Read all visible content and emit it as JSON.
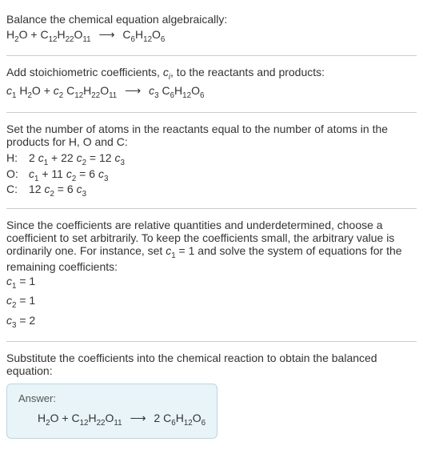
{
  "intro": {
    "line1": "Balance the chemical equation algebraically:"
  },
  "eq1": {
    "h2o": "H",
    "h2o_2": "2",
    "h2o_o": "O",
    "plus": " + ",
    "c12": "C",
    "c12_12": "12",
    "c12_h": "H",
    "c12_22": "22",
    "c12_o": "O",
    "c12_11": "11",
    "arrow": "⟶",
    "c6": "C",
    "c6_6": "6",
    "c6_h": "H",
    "c6_12": "12",
    "c6_o": "O",
    "c6_o6": "6"
  },
  "step2": {
    "text_a": "Add stoichiometric coefficients, ",
    "ci_c": "c",
    "ci_i": "i",
    "text_b": ", to the reactants and products:"
  },
  "eq2": {
    "c1": "c",
    "c1_1": "1",
    "sp1": " ",
    "c2": "c",
    "c2_2": "2",
    "sp2": " ",
    "c3": "c",
    "c3_3": "3",
    "sp3": " "
  },
  "step3": {
    "text": "Set the number of atoms in the reactants equal to the number of atoms in the products for H, O and C:"
  },
  "atoms": {
    "h_label": "H:",
    "h_eq_a": "2 ",
    "h_c1": "c",
    "h_1": "1",
    "h_plus": " + 22 ",
    "h_c2": "c",
    "h_2": "2",
    "h_eq": " = 12 ",
    "h_c3": "c",
    "h_3": "3",
    "o_label": "O:",
    "o_c1": "c",
    "o_1": "1",
    "o_plus": " + 11 ",
    "o_c2": "c",
    "o_2": "2",
    "o_eq": " = 6 ",
    "o_c3": "c",
    "o_3": "3",
    "c_label": "C:",
    "c_12": "12 ",
    "c_c2": "c",
    "c_2": "2",
    "c_eq": " = 6 ",
    "c_c3": "c",
    "c_3": "3"
  },
  "step4": {
    "text_a": "Since the coefficients are relative quantities and underdetermined, choose a coefficient to set arbitrarily. To keep the coefficients small, the arbitrary value is ordinarily one. For instance, set ",
    "c1": "c",
    "c1_1": "1",
    "text_b": " = 1 and solve the system of equations for the remaining coefficients:"
  },
  "coeffs": {
    "l1_c": "c",
    "l1_1": "1",
    "l1_v": " = 1",
    "l2_c": "c",
    "l2_2": "2",
    "l2_v": " = 1",
    "l3_c": "c",
    "l3_3": "3",
    "l3_v": " = 2"
  },
  "step5": {
    "text": "Substitute the coefficients into the chemical reaction to obtain the balanced equation:"
  },
  "answer": {
    "label": "Answer:",
    "two": "2 "
  },
  "chart_data": {
    "type": "table",
    "title": "Chemical equation balancing",
    "unbalanced": "H2O + C12H22O11 -> C6H12O6",
    "atom_equations": [
      {
        "element": "H",
        "equation": "2 c1 + 22 c2 = 12 c3"
      },
      {
        "element": "O",
        "equation": "c1 + 11 c2 = 6 c3"
      },
      {
        "element": "C",
        "equation": "12 c2 = 6 c3"
      }
    ],
    "solution": {
      "c1": 1,
      "c2": 1,
      "c3": 2
    },
    "balanced": "H2O + C12H22O11 -> 2 C6H12O6"
  }
}
